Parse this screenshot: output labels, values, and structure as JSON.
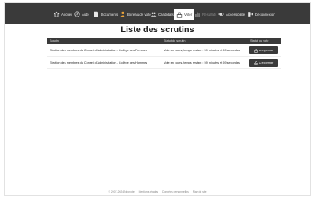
{
  "nav": {
    "items": [
      {
        "label": "Accueil",
        "icon": "home-icon"
      },
      {
        "label": "Aide",
        "icon": "help-icon"
      },
      {
        "label": "Documents",
        "icon": "document-icon"
      },
      {
        "label": "Bureau de vote",
        "icon": "bureau-icon"
      },
      {
        "label": "Candidats",
        "icon": "candidates-icon"
      },
      {
        "label": "Voter",
        "icon": "ballot-icon",
        "active": true
      },
      {
        "label": "Résultats",
        "icon": "results-icon",
        "disabled": true
      },
      {
        "label": "Accessibilité",
        "icon": "eye-icon"
      },
      {
        "label": "Déconnexion",
        "icon": "logout-icon"
      }
    ]
  },
  "main": {
    "title": "Liste des scrutins",
    "table": {
      "headers": [
        "Scrutin",
        "Statut du scrutin",
        "Statut du vote"
      ],
      "rows": [
        {
          "scrutin": "Election des membres du Conseil d'Administration - Collège des Femmes",
          "statut": "Vote en cours, temps restant : 59 minutes et 59 secondes",
          "action": "A exprimer"
        },
        {
          "scrutin": "Election des membres du Conseil d'Administration - Collège des Hommes",
          "statut": "Vote en cours, temps restant : 59 minutes et 59 secondes",
          "action": "A exprimer"
        }
      ]
    }
  },
  "footer": {
    "copyright": "© 2007-2024 Neovote",
    "links": [
      "Mentions légales",
      "Données personnelles",
      "Plan du site"
    ]
  },
  "colors": {
    "nav_bg": "#3a3a3a",
    "header_bg": "#3a3a3a",
    "button_bg": "#3a3a3a"
  }
}
